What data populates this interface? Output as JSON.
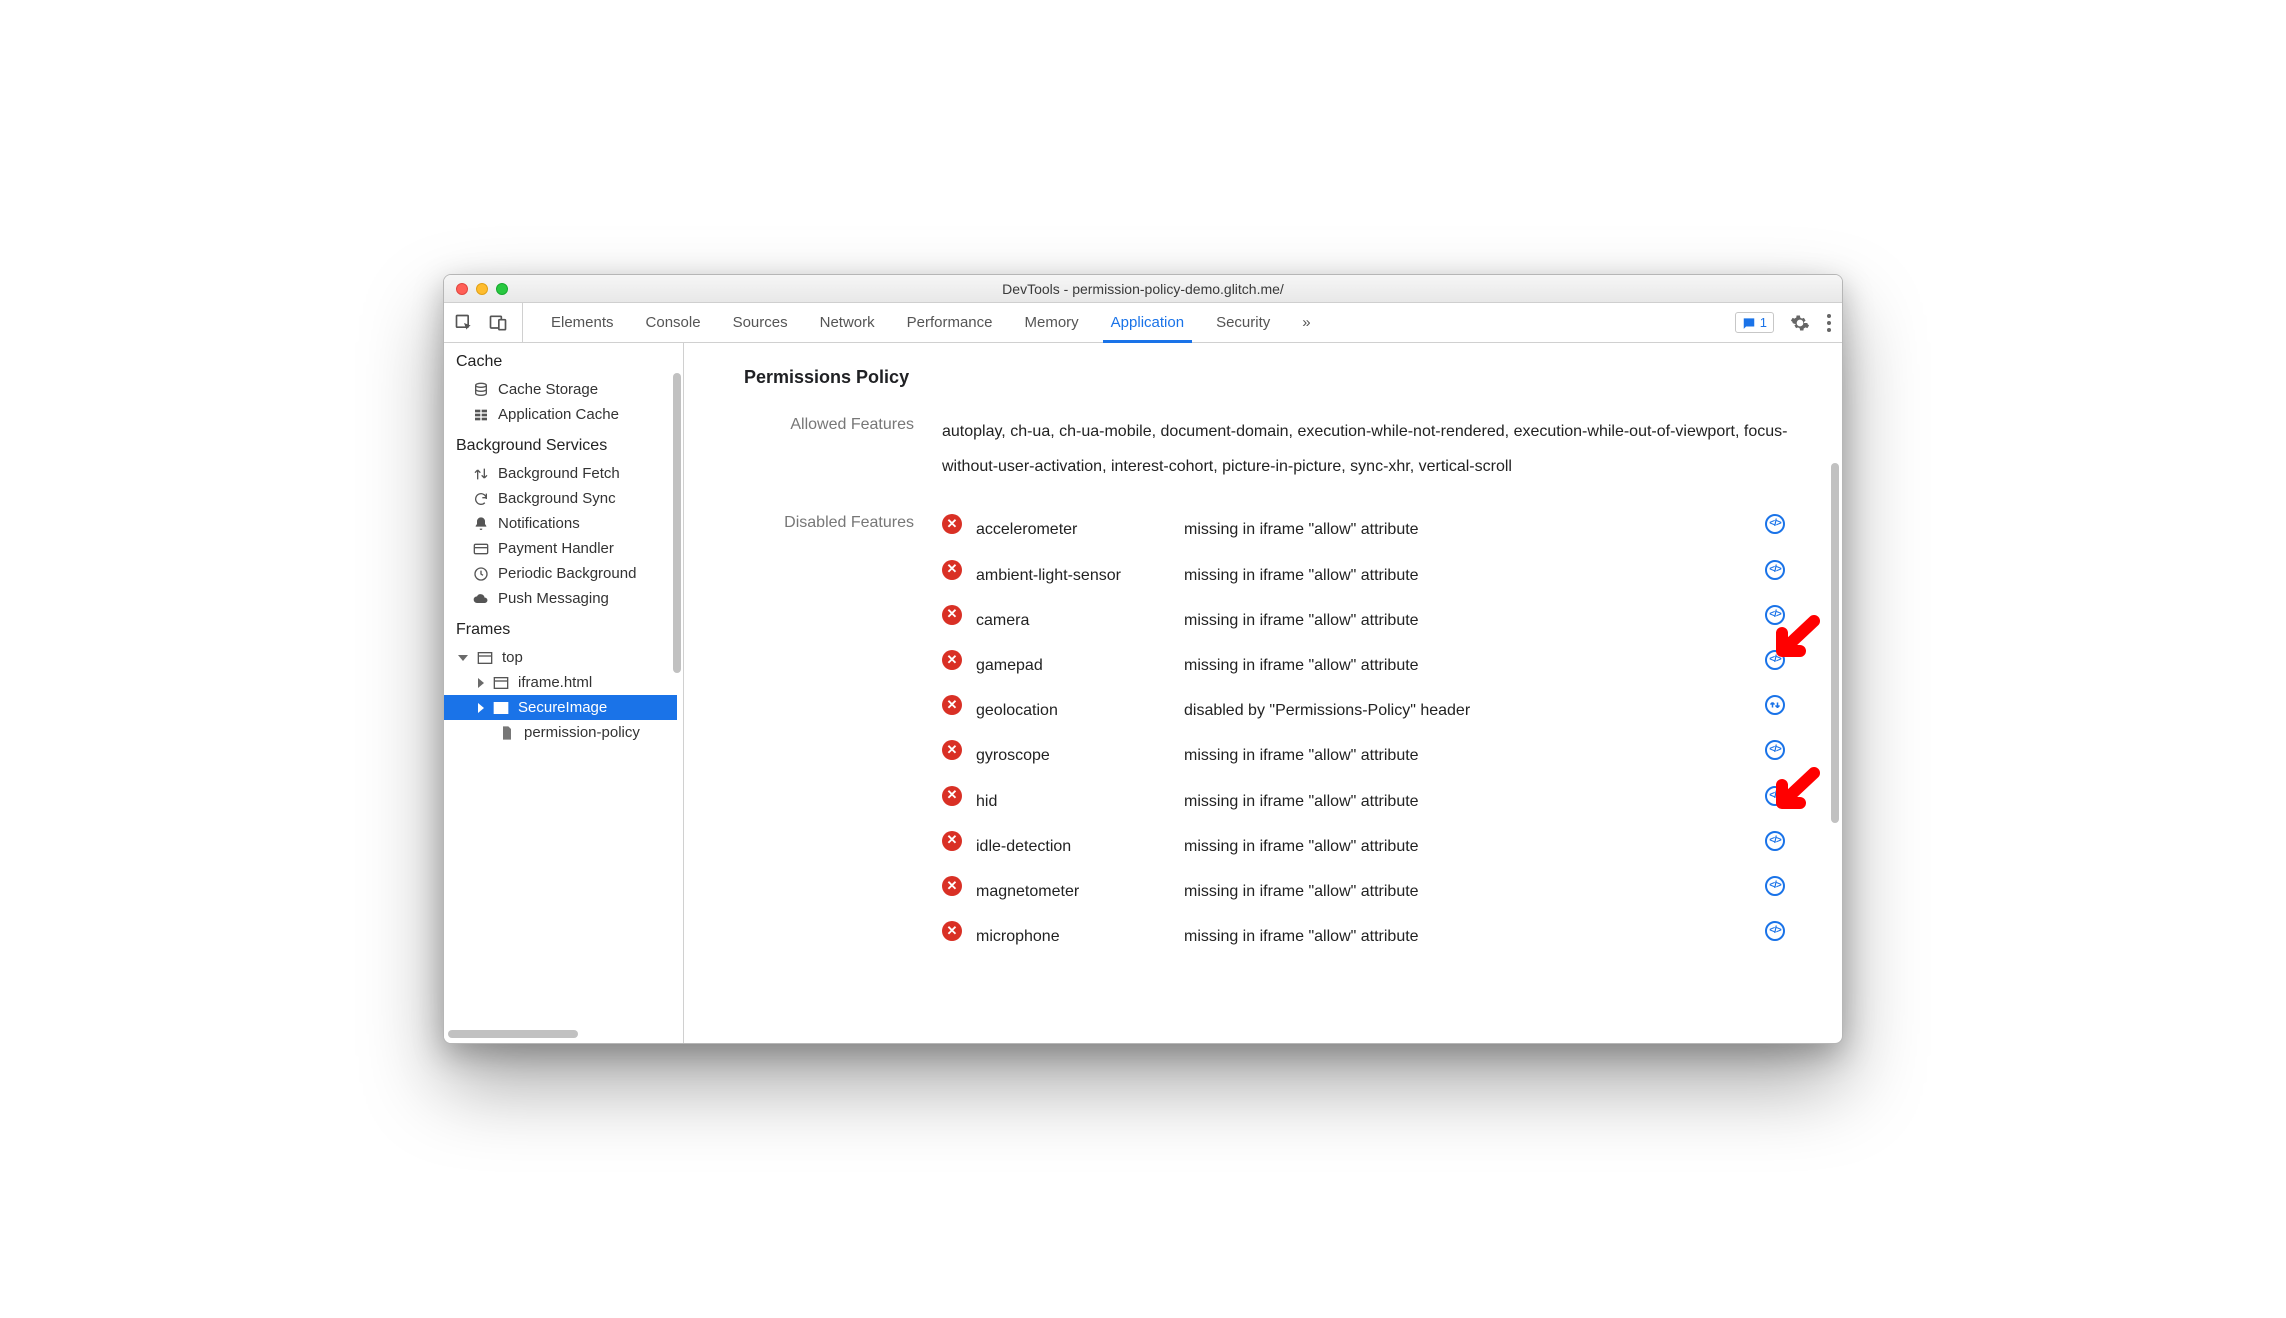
{
  "window": {
    "title": "DevTools - permission-policy-demo.glitch.me/"
  },
  "toolbar": {
    "tabs": [
      "Elements",
      "Console",
      "Sources",
      "Network",
      "Performance",
      "Memory",
      "Application",
      "Security"
    ],
    "active_tab_index": 6,
    "issues_count": "1"
  },
  "sidebar": {
    "sections": {
      "cache": {
        "title": "Cache",
        "items": [
          {
            "label": "Cache Storage"
          },
          {
            "label": "Application Cache"
          }
        ]
      },
      "background_services": {
        "title": "Background Services",
        "items": [
          {
            "label": "Background Fetch"
          },
          {
            "label": "Background Sync"
          },
          {
            "label": "Notifications"
          },
          {
            "label": "Payment Handler"
          },
          {
            "label": "Periodic Background"
          },
          {
            "label": "Push Messaging"
          }
        ]
      },
      "frames": {
        "title": "Frames",
        "top_label": "top",
        "children": [
          {
            "label": "iframe.html",
            "selected": false
          },
          {
            "label": "SecureImage",
            "selected": true
          },
          {
            "label": "permission-policy",
            "selected": false,
            "leaf": true
          }
        ]
      }
    }
  },
  "panel": {
    "title": "Permissions Policy",
    "allowed_label": "Allowed Features",
    "disabled_label": "Disabled Features",
    "allowed_text": "autoplay, ch-ua, ch-ua-mobile, document-domain, execution-while-not-rendered, execution-while-out-of-viewport, focus-without-user-activation, interest-cohort, picture-in-picture, sync-xhr, vertical-scroll",
    "disabled": [
      {
        "name": "accelerometer",
        "reason": "missing in iframe \"allow\" attribute",
        "link_type": "code"
      },
      {
        "name": "ambient-light-sensor",
        "reason": "missing in iframe \"allow\" attribute",
        "link_type": "code"
      },
      {
        "name": "camera",
        "reason": "missing in iframe \"allow\" attribute",
        "link_type": "code"
      },
      {
        "name": "gamepad",
        "reason": "missing in iframe \"allow\" attribute",
        "link_type": "code"
      },
      {
        "name": "geolocation",
        "reason": "disabled by \"Permissions-Policy\" header",
        "link_type": "net"
      },
      {
        "name": "gyroscope",
        "reason": "missing in iframe \"allow\" attribute",
        "link_type": "code"
      },
      {
        "name": "hid",
        "reason": "missing in iframe \"allow\" attribute",
        "link_type": "code"
      },
      {
        "name": "idle-detection",
        "reason": "missing in iframe \"allow\" attribute",
        "link_type": "code"
      },
      {
        "name": "magnetometer",
        "reason": "missing in iframe \"allow\" attribute",
        "link_type": "code"
      },
      {
        "name": "microphone",
        "reason": "missing in iframe \"allow\" attribute",
        "link_type": "code"
      }
    ]
  }
}
